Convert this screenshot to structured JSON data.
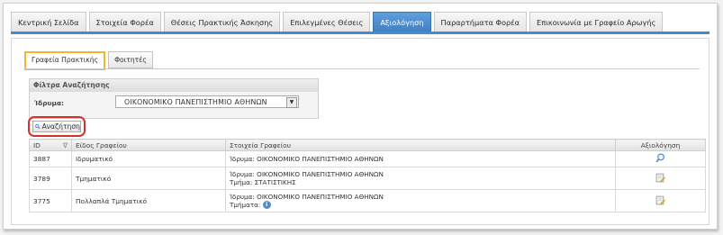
{
  "nav": {
    "tabs": [
      {
        "label": "Κεντρική Σελίδα",
        "active": false
      },
      {
        "label": "Στοιχεία Φορέα",
        "active": false
      },
      {
        "label": "Θέσεις Πρακτικής Άσκησης",
        "active": false
      },
      {
        "label": "Επιλεγμένες Θέσεις",
        "active": false
      },
      {
        "label": "Αξιολόγηση",
        "active": true
      },
      {
        "label": "Παραρτήματα Φορέα",
        "active": false
      },
      {
        "label": "Επικοινωνία με Γραφείο Αρωγής",
        "active": false
      }
    ]
  },
  "subtabs": [
    {
      "label": "Γραφεία Πρακτικής",
      "active": true
    },
    {
      "label": "Φοιτητές",
      "active": false
    }
  ],
  "filter": {
    "title": "Φίλτρα Αναζήτησης",
    "institution_label": "Ίδρυμα:",
    "institution_value": "ΟΙΚΟΝΟΜΙΚΟ ΠΑΝΕΠΙΣΤΗΜΙΟ ΑΘΗΝΩΝ"
  },
  "search_button": {
    "label": "Αναζήτηση",
    "icon": "magnifier-icon"
  },
  "table": {
    "headers": {
      "id": "ID",
      "sort_glyph": "∇",
      "type": "Είδος Γραφείου",
      "details": "Στοιχεία Γραφείου",
      "evaluation": "Αξιολόγηση"
    },
    "rows": [
      {
        "id": "3887",
        "type": "Ιδρυματικό",
        "institution_label": "Ίδρυμα:",
        "institution": "ΟΙΚΟΝΟΜΙΚΟ ΠΑΝΕΠΙΣΤΗΜΙΟ ΑΘΗΝΩΝ",
        "department_label": "",
        "department": "",
        "action_icon": "magnifier-icon"
      },
      {
        "id": "3789",
        "type": "Τμηματικό",
        "institution_label": "Ίδρυμα:",
        "institution": "ΟΙΚΟΝΟΜΙΚΟ ΠΑΝΕΠΙΣΤΗΜΙΟ ΑΘΗΝΩΝ",
        "department_label": "Τμήμα:",
        "department": "ΣΤΑΤΙΣΤΙΚΗΣ",
        "action_icon": "edit-document-icon"
      },
      {
        "id": "3775",
        "type": "Πολλαπλά Τμηματικό",
        "institution_label": "Ίδρυμα:",
        "institution": "ΟΙΚΟΝΟΜΙΚΟ ΠΑΝΕΠΙΣΤΗΜΙΟ ΑΘΗΝΩΝ",
        "department_label": "Τμήματα:",
        "department": "",
        "action_icon": "edit-document-icon"
      }
    ]
  },
  "colors": {
    "accent": "#4a89c8",
    "active_subtab_border": "#f3b62a",
    "highlight_red": "#d6302a"
  }
}
